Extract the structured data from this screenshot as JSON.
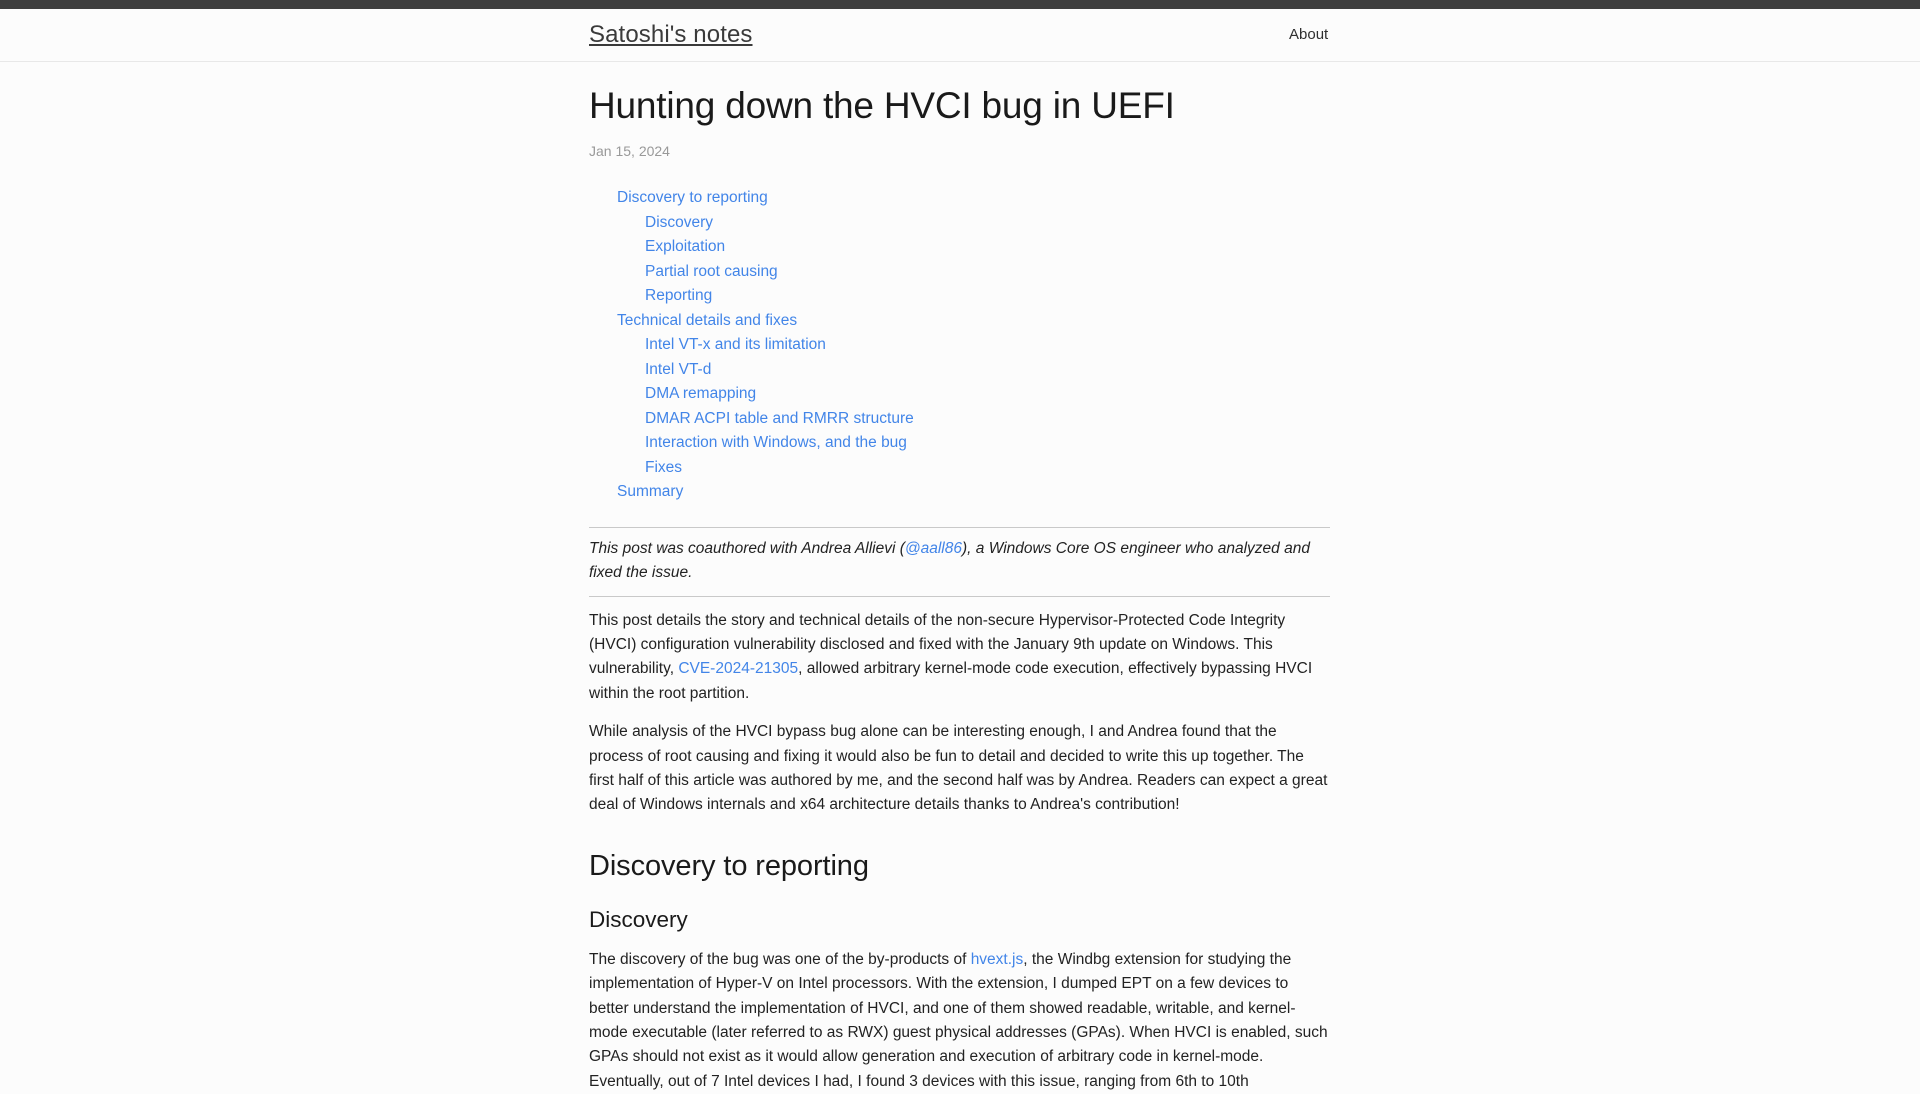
{
  "site": {
    "title": "Satoshi's notes",
    "nav": [
      {
        "label": "About"
      }
    ]
  },
  "post": {
    "title": "Hunting down the HVCI bug in UEFI",
    "date": "Jan 15, 2024"
  },
  "toc": [
    {
      "label": "Discovery to reporting",
      "children": [
        {
          "label": "Discovery"
        },
        {
          "label": "Exploitation"
        },
        {
          "label": "Partial root causing"
        },
        {
          "label": "Reporting"
        }
      ]
    },
    {
      "label": "Technical details and fixes",
      "children": [
        {
          "label": "Intel VT-x and its limitation"
        },
        {
          "label": "Intel VT-d"
        },
        {
          "label": "DMA remapping"
        },
        {
          "label": "DMAR ACPI table and RMRR structure"
        },
        {
          "label": "Interaction with Windows, and the bug"
        },
        {
          "label": "Fixes"
        }
      ]
    },
    {
      "label": "Summary",
      "children": []
    }
  ],
  "note": {
    "text_before_link": "This post was coauthored with Andrea Allievi (",
    "link_label": "@aall86",
    "text_after_link": "), a Windows Core OS engineer who analyzed and fixed the issue."
  },
  "intro": {
    "para1_before_link": "This post details the story and technical details of the non-secure Hypervisor-Protected Code Integrity (HVCI) configuration vulnerability disclosed and fixed with the January 9th update on Windows. This vulnerability, ",
    "para1_link_label": "CVE-2024-21305",
    "para1_after_link": ", allowed arbitrary kernel-mode code execution, effectively bypassing HVCI within the root partition.",
    "para2": "While analysis of the HVCI bypass bug alone can be interesting enough, I and Andrea found that the process of root causing and fixing it would also be fun to detail and decided to write this up together. The first half of this article was authored by me, and the second half was by Andrea. Readers can expect a great deal of Windows internals and x64 architecture details thanks to Andrea's contribution!"
  },
  "sections": {
    "discovery_to_reporting": "Discovery to reporting",
    "discovery": "Discovery",
    "discovery_para_before_link": "The discovery of the bug was one of the by-products of ",
    "discovery_link_label": "hvext.js",
    "discovery_para_after_link": ", the Windbg extension for studying the implementation of Hyper-V on Intel processors. With the extension, I dumped EPT on a few devices to better understand the implementation of HVCI, and one of them showed readable, writable, and kernel-mode executable (later referred to as RWX) guest physical addresses (GPAs). When HVCI is enabled, such GPAs should not exist as it would allow generation and execution of arbitrary code in kernel-mode. Eventually, out of 7 Intel devices I had, I found 3 devices with this issue, ranging from 6th to 10th"
  },
  "colors": {
    "link": "#4285e8",
    "top_bar": "#3f3f3f",
    "text": "#222222",
    "muted": "#999999",
    "background": "#fcfcfc"
  }
}
